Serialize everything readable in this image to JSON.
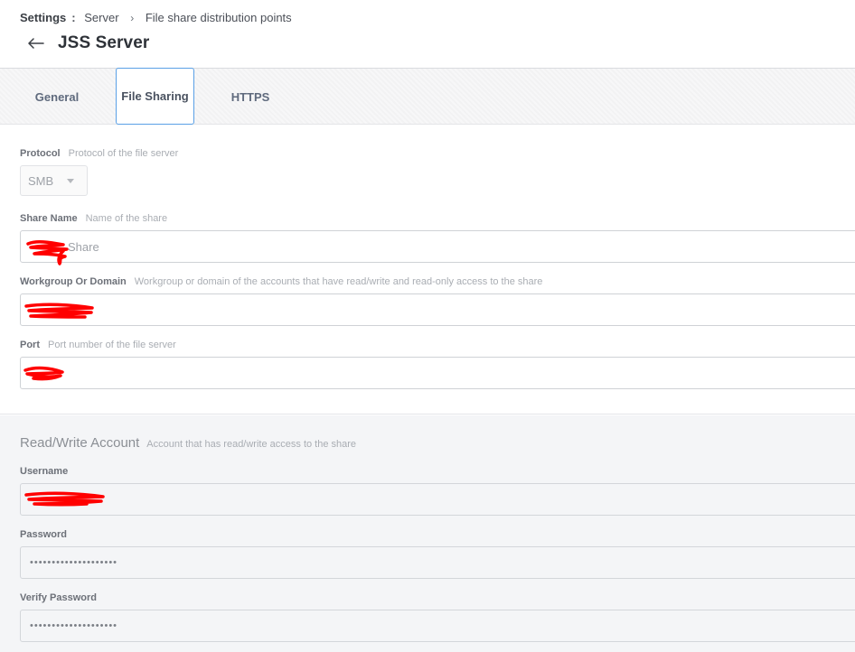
{
  "breadcrumb": {
    "root": "Settings",
    "colon": ":",
    "items": [
      "Server",
      "File share distribution points"
    ]
  },
  "page_title": "JSS Server",
  "tabs": [
    {
      "label": "General",
      "selected": false
    },
    {
      "label": "File Sharing",
      "selected": true
    },
    {
      "label": "HTTPS",
      "selected": false
    }
  ],
  "protocol": {
    "label": "Protocol",
    "hint": "Protocol of the file server",
    "value": "SMB"
  },
  "share_name": {
    "label": "Share Name",
    "hint": "Name of the share",
    "value": "Share"
  },
  "workgroup": {
    "label": "Workgroup Or Domain",
    "hint": "Workgroup or domain of the accounts that have read/write and read-only access to the share"
  },
  "port": {
    "label": "Port",
    "hint": "Port number of the file server"
  },
  "rw_account": {
    "title": "Read/Write Account",
    "hint": "Account that has read/write access to the share",
    "username_label": "Username",
    "password_label": "Password",
    "password_value": "••••••••••••••••••••",
    "verify_label": "Verify Password",
    "verify_value": "••••••••••••••••••••"
  },
  "colors": {
    "tab_selected_border": "#5aa0e6",
    "redaction": "#ff0000"
  },
  "icons": {
    "back": "left-arrow-icon",
    "breadcrumb_separator": "chevron-right-icon",
    "select_caret": "caret-down-icon"
  }
}
